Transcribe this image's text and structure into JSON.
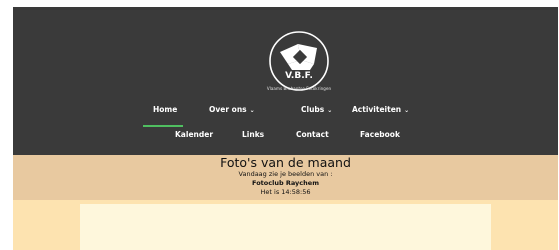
{
  "logo": {
    "initials": "V.B.F.",
    "subtitle": "Vlaams Brabantse Fotokringen"
  },
  "nav": {
    "primary": [
      {
        "label": "Home",
        "has_dropdown": false,
        "active": true
      },
      {
        "label": "Over ons",
        "has_dropdown": true
      },
      {
        "label": "Clubs",
        "has_dropdown": true
      },
      {
        "label": "Activiteiten",
        "has_dropdown": true
      }
    ],
    "secondary": [
      {
        "label": "Kalender"
      },
      {
        "label": "Links"
      },
      {
        "label": "Contact"
      },
      {
        "label": "Facebook"
      }
    ],
    "dropdown_glyph": "⌄"
  },
  "hero": {
    "title": "Foto's van de maand",
    "intro": "Vandaag zie je beelden van :",
    "club": "Fotoclub Raychem",
    "time": "Het is 14:58:56"
  },
  "colors": {
    "header_bg": "#3a3a3a",
    "active_underline": "#4fbf60",
    "band_bg": "#e8c9a0",
    "lower_bg": "#fde3b0",
    "content_bg": "#fef7dc"
  }
}
